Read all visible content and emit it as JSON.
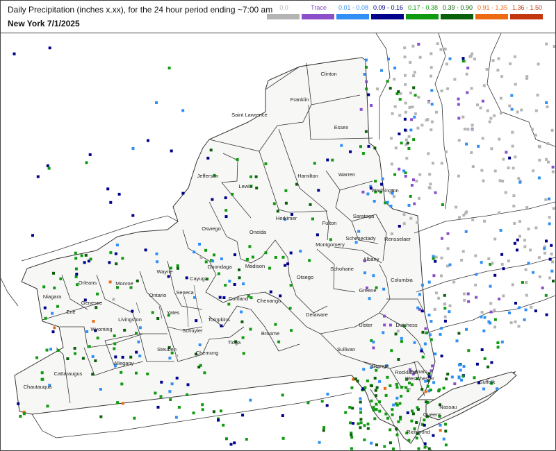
{
  "title": "Daily Precipitation (inches  x.xx),  for the 24 hour period ending ~7:00 am",
  "subtitle": "New York 7/1/2025",
  "legend": [
    {
      "label": "0.0",
      "color": "#b4b4b4"
    },
    {
      "label": "Trace",
      "color": "#8a4fc9"
    },
    {
      "label": "0.01 - 0.08",
      "color": "#2f8ff5"
    },
    {
      "label": "0.09 - 0.16",
      "color": "#00008c"
    },
    {
      "label": "0.17 - 0.38",
      "color": "#0f9a0f"
    },
    {
      "label": "0.39 - 0.90",
      "color": "#0a5f0a"
    },
    {
      "label": "0.91 - 1.35",
      "color": "#ee6a12"
    },
    {
      "label": "1.36 - 1.50",
      "color": "#c4360e"
    }
  ],
  "counties": [
    "Clinton",
    "Franklin",
    "Essex",
    "Saint Lawrence",
    "Jefferson",
    "Lewis",
    "Hamilton",
    "Warren",
    "Washington",
    "Herkimer",
    "Oneida",
    "Oswego",
    "Fulton",
    "Saratoga",
    "Montgomery",
    "Schenectady",
    "Rensselaer",
    "Albany",
    "Schoharie",
    "Otsego",
    "Madison",
    "Onondaga",
    "Cayuga",
    "Wayne",
    "Orleans",
    "Monroe",
    "Niagara",
    "Genesee",
    "Ontario",
    "Seneca",
    "Cortland",
    "Chenango",
    "Columbia",
    "Greene",
    "Delaware",
    "Erie",
    "Wyoming",
    "Livingston",
    "Yates",
    "Schuyler",
    "Tompkins",
    "Broome",
    "Ulster",
    "Dutchess",
    "Steuben",
    "Chemung",
    "Tioga",
    "Allegany",
    "Cattaraugus",
    "Chautauqua",
    "Sullivan",
    "Putnam",
    "Orange",
    "Rockland",
    "Westchester",
    "Suffolk",
    "Nassau",
    "Queens",
    "Richmond"
  ]
}
